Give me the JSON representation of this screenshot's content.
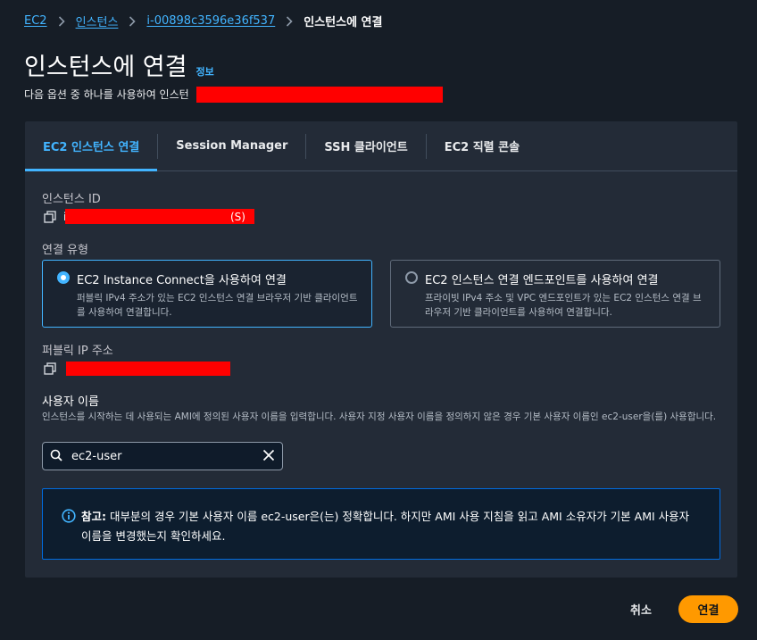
{
  "breadcrumb": {
    "items": [
      "EC2",
      "인스턴스",
      "i-00898c3596e36f537"
    ],
    "current": "인스턴스에 연결"
  },
  "header": {
    "title": "인스턴스에 연결",
    "info_label": "정보",
    "description": "다음 옵션 중 하나를 사용하여 인스턴"
  },
  "tabs": [
    {
      "label": "EC2 인스턴스 연결",
      "active": true
    },
    {
      "label": "Session Manager",
      "active": false
    },
    {
      "label": "SSH 클라이언트",
      "active": false
    },
    {
      "label": "EC2 직렬 콘솔",
      "active": false
    }
  ],
  "instance_id": {
    "label": "인스턴스 ID",
    "value_prefix": "i",
    "value_suffix": "(S)"
  },
  "connection_type": {
    "label": "연결 유형",
    "options": [
      {
        "title": "EC2 Instance Connect을 사용하여 연결",
        "description": "퍼블릭 IPv4 주소가 있는 EC2 인스턴스 연결 브라우저 기반 클라이언트를 사용하여 연결합니다.",
        "selected": true
      },
      {
        "title": "EC2 인스턴스 연결 엔드포인트를 사용하여 연결",
        "description": "프라이빗 IPv4 주소 및 VPC 엔드포인트가 있는 EC2 인스턴스 연결 브라우저 기반 클라이언트를 사용하여 연결합니다.",
        "selected": false
      }
    ]
  },
  "public_ip": {
    "label": "퍼블릭 IP 주소"
  },
  "username": {
    "label": "사용자 이름",
    "description": "인스턴스를 시작하는 데 사용되는 AMI에 정의된 사용자 이름을 입력합니다. 사용자 지정 사용자 이름을 정의하지 않은 경우 기본 사용자 이름인 ec2-user을(를) 사용합니다.",
    "value": "ec2-user"
  },
  "note": {
    "bold": "참고:",
    "text": " 대부분의 경우 기본 사용자 이름 ec2-user은(는) 정확합니다. 하지만 AMI 사용 지침을 읽고 AMI 소유자가 기본 AMI 사용자 이름을 변경했는지 확인하세요."
  },
  "footer": {
    "cancel_label": "취소",
    "connect_label": "연결"
  },
  "colors": {
    "accent": "#42b4ff",
    "primary_button": "#ff9900",
    "redaction": "#ff0000"
  }
}
